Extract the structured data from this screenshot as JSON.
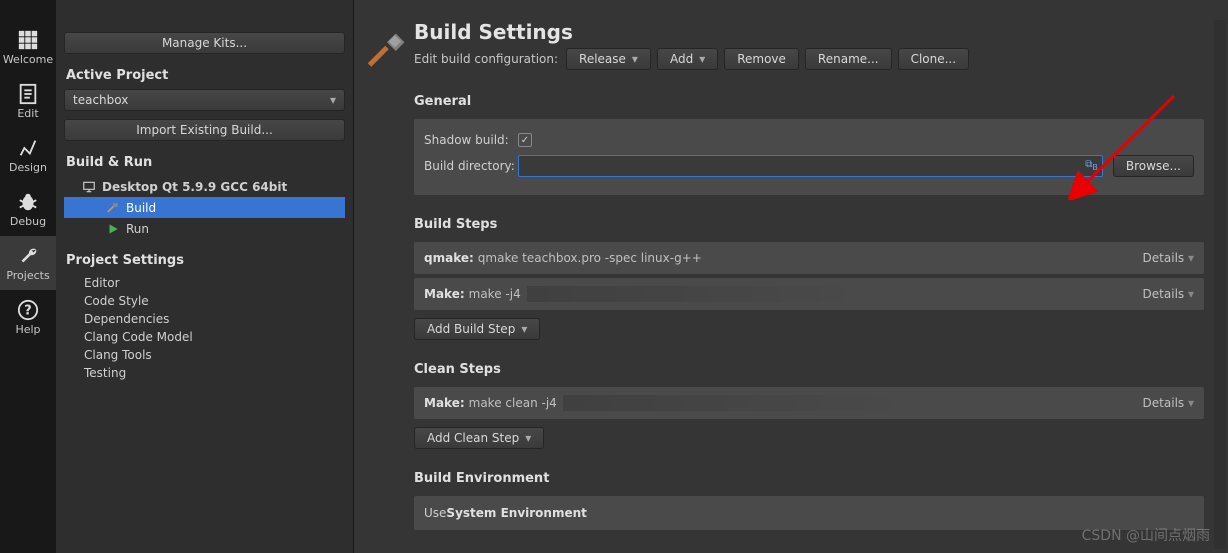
{
  "iconbar": {
    "items": [
      {
        "label": "Welcome"
      },
      {
        "label": "Edit"
      },
      {
        "label": "Design"
      },
      {
        "label": "Debug"
      },
      {
        "label": "Projects"
      },
      {
        "label": "Help"
      }
    ]
  },
  "sidebar": {
    "manage_kits": "Manage Kits...",
    "active_project_h": "Active Project",
    "project_name": "teachbox",
    "import_build": "Import Existing Build...",
    "build_run_h": "Build & Run",
    "kit_name": "Desktop Qt 5.9.9 GCC 64bit",
    "build_label": "Build",
    "run_label": "Run",
    "project_settings_h": "Project Settings",
    "settings": [
      "Editor",
      "Code Style",
      "Dependencies",
      "Clang Code Model",
      "Clang Tools",
      "Testing"
    ]
  },
  "main": {
    "title": "Build Settings",
    "edit_config_label": "Edit build configuration:",
    "config_value": "Release",
    "add_btn": "Add",
    "remove_btn": "Remove",
    "rename_btn": "Rename...",
    "clone_btn": "Clone...",
    "general_h": "General",
    "shadow_label": "Shadow build:",
    "shadow_checked": "✓",
    "build_dir_label": "Build directory:",
    "build_dir_value": "",
    "browse_btn": "Browse...",
    "build_steps_h": "Build Steps",
    "qmake_label": "qmake:",
    "qmake_cmd": "qmake teachbox.pro -spec linux-g++",
    "make_label": "Make:",
    "make_cmd": "make -j4",
    "details": "Details",
    "add_build_step": "Add Build Step",
    "clean_steps_h": "Clean Steps",
    "clean_make_label": "Make:",
    "clean_make_cmd": "make clean -j4",
    "add_clean_step": "Add Clean Step",
    "build_env_h": "Build Environment",
    "env_use": "Use ",
    "env_sys": "System Environment"
  },
  "watermark": "CSDN @山间点烟雨"
}
